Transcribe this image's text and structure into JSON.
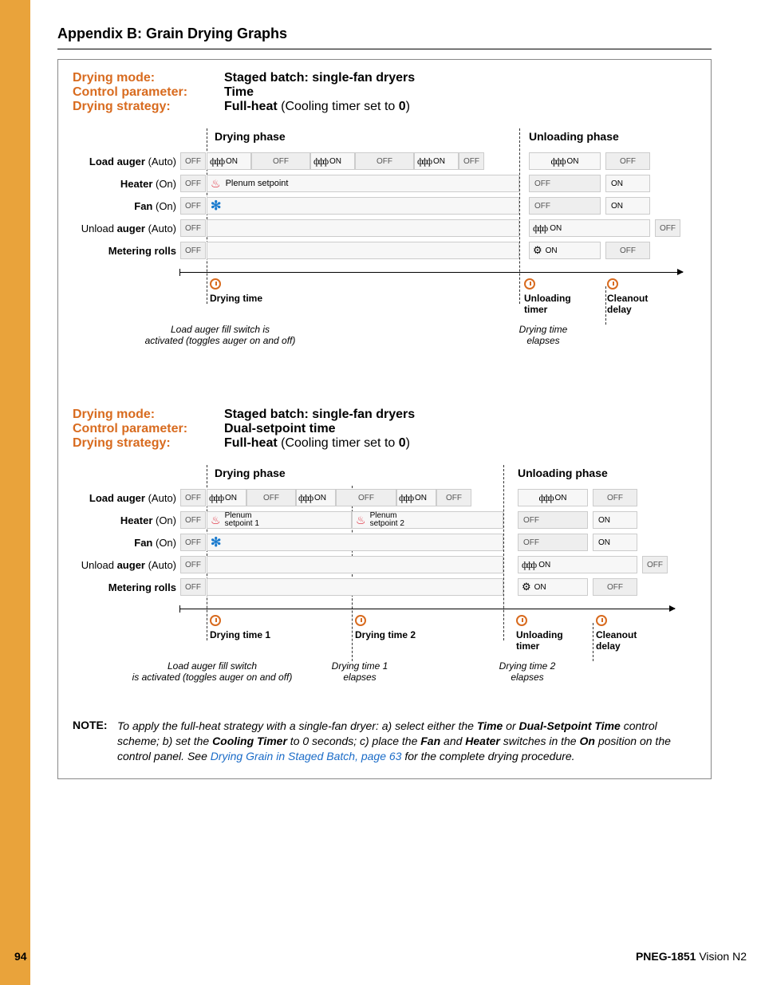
{
  "chart_data": [
    {
      "type": "table",
      "title": "Staged batch single-fan full-heat (Time)",
      "phases": [
        "Drying phase",
        "Unloading phase"
      ],
      "rows": [
        {
          "name": "Load auger",
          "state": "Auto",
          "drying": [
            "OFF",
            "ON",
            "OFF",
            "ON",
            "OFF",
            "ON",
            "OFF"
          ],
          "unloading_timer": [
            "ON"
          ],
          "cleanout": [
            "OFF"
          ]
        },
        {
          "name": "Heater",
          "state": "On",
          "drying": [
            "OFF",
            "Plenum setpoint"
          ],
          "unloading_timer": [
            "OFF"
          ],
          "cleanout": [
            "ON"
          ]
        },
        {
          "name": "Fan",
          "state": "On",
          "drying": [
            "OFF",
            "(on)"
          ],
          "unloading_timer": [
            "OFF"
          ],
          "cleanout": [
            "ON"
          ]
        },
        {
          "name": "Unload auger",
          "state": "Auto",
          "drying": [
            "OFF"
          ],
          "unloading_timer": [
            "ON"
          ],
          "cleanout": [
            ""
          ],
          "post": [
            "OFF"
          ]
        },
        {
          "name": "Metering rolls",
          "state": "",
          "drying": [
            "OFF"
          ],
          "unloading_timer": [
            "ON"
          ],
          "cleanout": [
            "OFF"
          ]
        }
      ],
      "timeline": [
        "Drying time",
        "Unloading timer",
        "Cleanout delay"
      ],
      "footnotes": [
        "Load auger fill switch is activated (toggles auger on and off)",
        "Drying time elapses"
      ]
    },
    {
      "type": "table",
      "title": "Staged batch single-fan full-heat (Dual-setpoint time)",
      "phases": [
        "Drying phase",
        "Unloading phase"
      ],
      "rows": [
        {
          "name": "Load auger",
          "state": "Auto",
          "drying": [
            "OFF",
            "ON",
            "OFF",
            "ON",
            "OFF",
            "ON",
            "OFF"
          ],
          "unloading_timer": [
            "ON"
          ],
          "cleanout": [
            "OFF"
          ]
        },
        {
          "name": "Heater",
          "state": "On",
          "drying": [
            "OFF",
            "Plenum setpoint 1",
            "Plenum setpoint 2"
          ],
          "unloading_timer": [
            "OFF"
          ],
          "cleanout": [
            "ON"
          ]
        },
        {
          "name": "Fan",
          "state": "On",
          "drying": [
            "OFF",
            "(on)"
          ],
          "unloading_timer": [
            "OFF"
          ],
          "cleanout": [
            "ON"
          ]
        },
        {
          "name": "Unload auger",
          "state": "Auto",
          "drying": [
            "OFF"
          ],
          "unloading_timer": [
            "ON"
          ],
          "cleanout": [
            ""
          ],
          "post": [
            "OFF"
          ]
        },
        {
          "name": "Metering rolls",
          "state": "",
          "drying": [
            "OFF"
          ],
          "unloading_timer": [
            "ON"
          ],
          "cleanout": [
            "OFF"
          ]
        }
      ],
      "timeline": [
        "Drying time 1",
        "Drying time 2",
        "Unloading timer",
        "Cleanout delay"
      ],
      "footnotes": [
        "Load auger fill switch is activated (toggles auger on and off)",
        "Drying time 1 elapses",
        "Drying time 2 elapses"
      ]
    }
  ],
  "appendix_title": "Appendix B: Grain Drying Graphs",
  "labels": {
    "drying_mode": "Drying mode:",
    "control_parameter": "Control parameter:",
    "drying_strategy": "Drying strategy:",
    "drying_phase": "Drying phase",
    "unloading_phase": "Unloading phase",
    "drying_time": "Drying time",
    "drying_time_1": "Drying time 1",
    "drying_time_2": "Drying time 2",
    "unloading_timer": "Unloading timer",
    "cleanout_delay": "Cleanout delay",
    "on": "ON",
    "off": "OFF",
    "plenum_setpoint": "Plenum setpoint",
    "plenum_setpoint_1": "Plenum setpoint 1",
    "plenum_setpoint_2": "Plenum setpoint 2"
  },
  "rows": {
    "load_auger_b": "Load auger",
    "load_auger_s": " (Auto)",
    "heater_b": "Heater",
    "heater_s": " (On)",
    "fan_b": "Fan",
    "fan_s": " (On)",
    "unload_pre": "Unload ",
    "unload_b": "auger",
    "unload_s": " (Auto)",
    "metering": "Metering rolls"
  },
  "section1": {
    "mode": "Staged batch: single-fan dryers",
    "param": "Time",
    "strategy_b": "Full-heat",
    "strategy_n": " (Cooling timer set to ",
    "strategy_z": "0",
    "strategy_end": ")"
  },
  "section2": {
    "mode": "Staged batch: single-fan dryers",
    "param": "Dual-setpoint time",
    "strategy_b": "Full-heat",
    "strategy_n": " (Cooling timer set to ",
    "strategy_z": "0",
    "strategy_end": ")"
  },
  "footnotes": {
    "load_auger_1": "Load auger fill switch is",
    "load_auger_2": "activated (toggles auger on and off)",
    "load_auger_b1": "Load auger fill switch",
    "load_auger_b2": "is activated (toggles auger on and off)",
    "drying_elapses_1": "Drying time",
    "drying_elapses_2": "elapses",
    "dt1_1": "Drying time 1",
    "dt1_2": "elapses",
    "dt2_1": "Drying time 2",
    "dt2_2": "elapses"
  },
  "note": {
    "label": "NOTE:",
    "t1": "To apply the full-heat strategy with a single-fan dryer: a) select either the ",
    "b1": "Time",
    "t2": " or ",
    "b2": "Dual-Setpoint Time",
    "t3": " control scheme; b) set the ",
    "b3": "Cooling Timer",
    "t4": " to 0 seconds; c) place the ",
    "b4": "Fan",
    "t5": " and ",
    "b5": "Heater",
    "t6": " switches in the ",
    "b6": "On",
    "t7": " position on the control panel. See ",
    "link": "Drying Grain in Staged Batch, page 63",
    "t8": " for the complete drying procedure."
  },
  "footer": {
    "page": "94",
    "doc_b": "PNEG-1851",
    "doc_n": " Vision N2"
  }
}
